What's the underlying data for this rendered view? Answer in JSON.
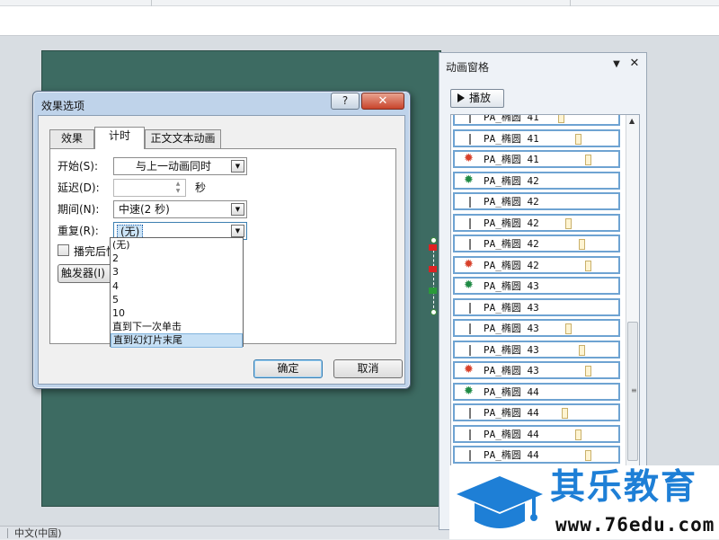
{
  "dialog": {
    "title": "效果选项",
    "help_label": "?",
    "close_label": "✕",
    "tabs": [
      {
        "label": "效果",
        "active": false
      },
      {
        "label": "计时",
        "active": true
      },
      {
        "label": "正文文本动画",
        "active": false
      }
    ],
    "fields": {
      "start": {
        "label": "开始(S):",
        "value": "与上一动画同时"
      },
      "delay": {
        "label": "延迟(D):",
        "value": "",
        "unit": "秒"
      },
      "duration": {
        "label": "期间(N):",
        "value": "中速(2 秒)"
      },
      "repeat": {
        "label": "重复(R):",
        "value": "(无)"
      }
    },
    "rewind_label": "播完后快",
    "trigger_label": "触发器(I)",
    "repeat_options": [
      "(无)",
      "2",
      "3",
      "4",
      "5",
      "10",
      "直到下一次单击",
      "直到幻灯片末尾"
    ],
    "repeat_highlighted_index": 7,
    "ok_label": "确定",
    "cancel_label": "取消"
  },
  "animation_pane": {
    "title": "动画窗格",
    "play_label": "播放",
    "items": [
      {
        "name": "PA_椭圆 41",
        "marker": "bar",
        "timing_bar": 0.62
      },
      {
        "name": "PA_椭圆 41",
        "marker": "bar",
        "timing_bar": 0.72
      },
      {
        "name": "PA_椭圆 41",
        "marker": "star-red",
        "timing_bar": 0.78
      },
      {
        "name": "PA_椭圆 42",
        "marker": "star-green",
        "timing_bar": null
      },
      {
        "name": "PA_椭圆 42",
        "marker": "bar",
        "timing_bar": null
      },
      {
        "name": "PA_椭圆 42",
        "marker": "bar",
        "timing_bar": 0.66
      },
      {
        "name": "PA_椭圆 42",
        "marker": "bar",
        "timing_bar": 0.74
      },
      {
        "name": "PA_椭圆 42",
        "marker": "star-red",
        "timing_bar": 0.78
      },
      {
        "name": "PA_椭圆 43",
        "marker": "star-green",
        "timing_bar": null
      },
      {
        "name": "PA_椭圆 43",
        "marker": "bar",
        "timing_bar": null
      },
      {
        "name": "PA_椭圆 43",
        "marker": "bar",
        "timing_bar": 0.66
      },
      {
        "name": "PA_椭圆 43",
        "marker": "bar",
        "timing_bar": 0.74
      },
      {
        "name": "PA_椭圆 43",
        "marker": "star-red",
        "timing_bar": 0.78
      },
      {
        "name": "PA_椭圆 44",
        "marker": "star-green",
        "timing_bar": null
      },
      {
        "name": "PA_椭圆 44",
        "marker": "bar",
        "timing_bar": 0.64
      },
      {
        "name": "PA_椭圆 44",
        "marker": "bar",
        "timing_bar": 0.72
      },
      {
        "name": "PA_椭圆 44",
        "marker": "bar",
        "timing_bar": 0.78
      }
    ]
  },
  "status_bar": {
    "language": "中文(中国)"
  },
  "watermark": {
    "brand": "其乐教育",
    "url": "www.76edu.com"
  },
  "colors": {
    "slide": "#3d6b62",
    "accent_blue": "#1e7fd6",
    "pane_border": "#6ea3d2"
  }
}
